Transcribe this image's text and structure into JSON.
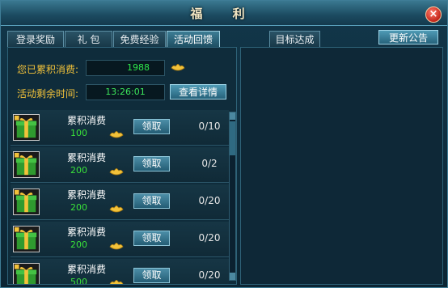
{
  "window": {
    "title": "福 利",
    "close_label": "×"
  },
  "tabs": [
    {
      "label": "登录奖励",
      "active": false
    },
    {
      "label": "礼 包",
      "active": false
    },
    {
      "label": "免费经验",
      "active": false
    },
    {
      "label": "活动回馈",
      "active": true
    },
    {
      "label": "目标达成",
      "active": false
    }
  ],
  "announce_button": "更新公告",
  "summary": {
    "spent_label": "您已累积消费:",
    "spent_value": "1988",
    "time_label": "活动剩余时间:",
    "time_value": "13:26:01",
    "detail_button": "查看详情"
  },
  "rewards": [
    {
      "name": "累积消费",
      "amount": "100",
      "button": "领取",
      "progress": "0/10"
    },
    {
      "name": "累积消费",
      "amount": "200",
      "button": "领取",
      "progress": "0/2"
    },
    {
      "name": "累积消费",
      "amount": "200",
      "button": "领取",
      "progress": "0/20"
    },
    {
      "name": "累积消费",
      "amount": "200",
      "button": "领取",
      "progress": "0/20"
    },
    {
      "name": "累积消费",
      "amount": "500",
      "button": "领取",
      "progress": "0/20"
    }
  ],
  "colors": {
    "gold": "#f2c23a",
    "green_text": "#39e13a",
    "panel": "#0f2c3b"
  },
  "icons": {
    "close": "close-icon",
    "ingot": "gold-ingot-icon",
    "gift": "gift-box-icon",
    "lock": "lock-icon"
  }
}
